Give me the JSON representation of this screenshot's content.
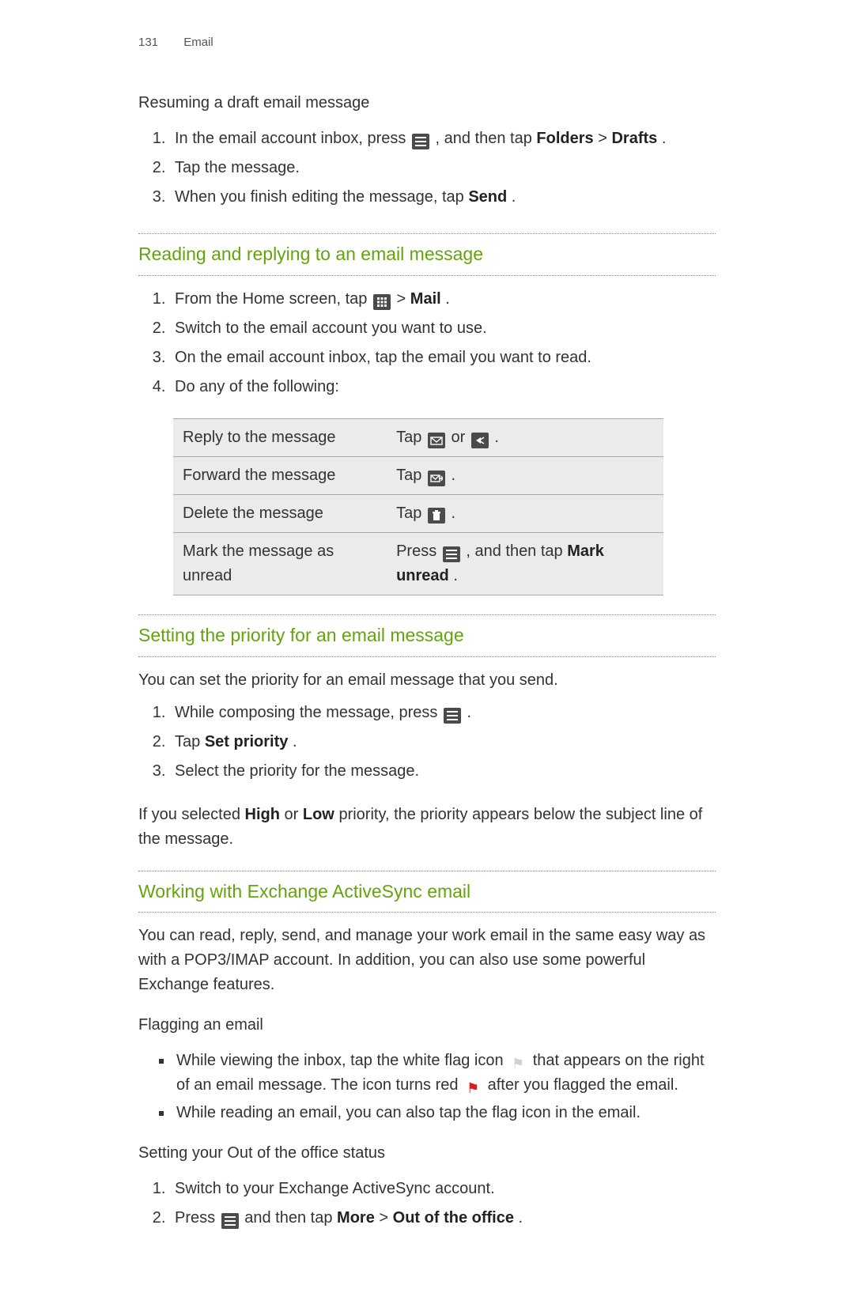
{
  "meta": {
    "page_number": "131",
    "section": "Email"
  },
  "resuming": {
    "heading": "Resuming a draft email message",
    "steps": {
      "s1a": "In the email account inbox, press ",
      "s1b": " , and then tap ",
      "s1_folders": "Folders",
      "s1_gt": " > ",
      "s1_drafts": "Drafts",
      "s1_end": ".",
      "s2": "Tap the message.",
      "s3a": "When you finish editing the message, tap ",
      "s3_send": "Send",
      "s3_end": "."
    }
  },
  "reading": {
    "title": "Reading and replying to an email message",
    "steps": {
      "s1a": "From the Home screen, tap ",
      "s1b": " > ",
      "s1_mail": "Mail",
      "s1_end": ".",
      "s2": "Switch to the email account you want to use.",
      "s3": "On the email account inbox, tap the email you want to read.",
      "s4": "Do any of the following:"
    },
    "table": {
      "r1c1": "Reply to the message",
      "r1c2a": "Tap ",
      "r1c2b": " or ",
      "r1c2c": ".",
      "r2c1": "Forward the message",
      "r2c2a": "Tap ",
      "r2c2b": ".",
      "r3c1": "Delete the message",
      "r3c2a": "Tap ",
      "r3c2b": ".",
      "r4c1": "Mark the message as unread",
      "r4c2a": "Press ",
      "r4c2b": ", and then tap ",
      "r4c2_mark": "Mark unread",
      "r4c2_end": "."
    }
  },
  "priority": {
    "title": "Setting the priority for an email message",
    "intro": "You can set the priority for an email message that you send.",
    "steps": {
      "s1a": "While composing the message, press ",
      "s1b": ".",
      "s2a": "Tap ",
      "s2_set": "Set priority",
      "s2_end": ".",
      "s3": "Select the priority for the message."
    },
    "note_a": "If you selected ",
    "note_high": "High",
    "note_or": " or ",
    "note_low": "Low",
    "note_b": " priority, the priority appears below the subject line of the message."
  },
  "exchange": {
    "title": "Working with Exchange ActiveSync email",
    "intro": "You can read, reply, send, and manage your work email in the same easy way as with a POP3/IMAP account. In addition, you can also use some powerful Exchange features.",
    "flagging": {
      "heading": "Flagging an email",
      "b1a": "While viewing the inbox, tap the white flag icon ",
      "b1b": " that appears on the right of an email message. The icon turns red ",
      "b1c": " after you flagged the email.",
      "b2": "While reading an email, you can also tap the flag icon in the email."
    },
    "ooo": {
      "heading": "Setting your Out of the office status",
      "s1": "Switch to your Exchange ActiveSync account.",
      "s2a": "Press ",
      "s2b": " and then tap ",
      "s2_more": "More",
      "s2_gt": " > ",
      "s2_out": "Out of the office",
      "s2_end": "."
    }
  }
}
